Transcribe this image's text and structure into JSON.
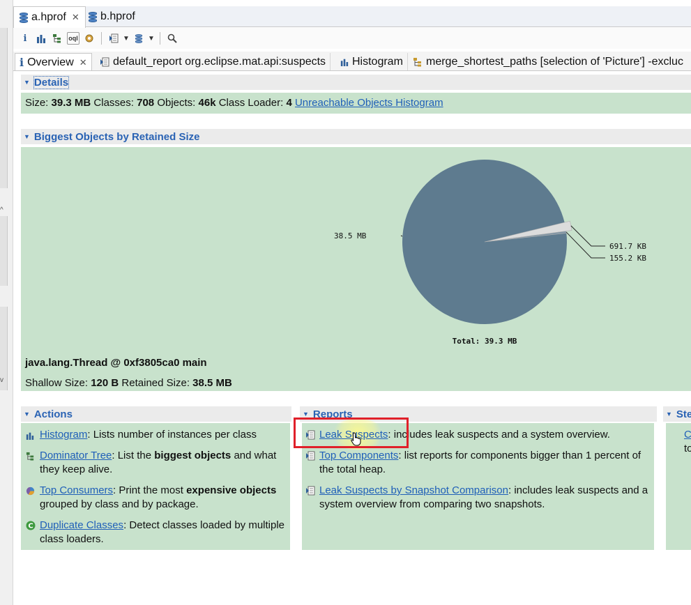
{
  "editor_tabs": [
    {
      "label": "a.hprof",
      "active": true
    },
    {
      "label": "b.hprof",
      "active": false
    }
  ],
  "toolbar": {
    "icons": [
      "info-icon",
      "histogram-icon",
      "dominator-tree-icon",
      "oql-icon",
      "heap-dump-overview-icon",
      "run-report-icon",
      "query-browser-icon",
      "search-icon"
    ]
  },
  "view_tabs": [
    {
      "label": "Overview",
      "active": true
    },
    {
      "label": "default_report  org.eclipse.mat.api:suspects"
    },
    {
      "label": "Histogram"
    },
    {
      "label": "merge_shortest_paths  [selection of 'Picture'] -excluc"
    }
  ],
  "details": {
    "header": "Details",
    "size_label": "Size:",
    "size_value": "39.3 MB",
    "classes_label": "Classes:",
    "classes_value": "708",
    "objects_label": "Objects:",
    "objects_value": "46k",
    "loader_label": "Class Loader:",
    "loader_value": "4",
    "unreachable_link": "Unreachable Objects Histogram"
  },
  "biggest": {
    "header": "Biggest Objects by Retained Size",
    "object_name": "java.lang.Thread @ 0xf3805ca0 main",
    "shallow_label": "Shallow Size:",
    "shallow_value": "120 B",
    "retained_label": "Retained Size:",
    "retained_value": "38.5 MB"
  },
  "chart_data": {
    "type": "pie",
    "slices": [
      {
        "label": "38.5 MB",
        "value": 38.5,
        "color": "#5e7b8f"
      },
      {
        "label": "691.7 KB",
        "value": 0.6755,
        "color": "#dcdcdc"
      },
      {
        "label": "155.2 KB",
        "value": 0.1516,
        "color": "#7f95a5"
      }
    ],
    "total_label": "Total: 39.3 MB"
  },
  "actions": {
    "header": "Actions",
    "items": [
      {
        "link": "Histogram",
        "pre": ": Lists number of instances per class",
        "bold": "",
        "post": ""
      },
      {
        "link": "Dominator Tree",
        "pre": ": List the ",
        "bold": "biggest objects",
        "post": " and what they keep alive."
      },
      {
        "link": "Top Consumers",
        "pre": ": Print the most ",
        "bold": "expensive objects",
        "post": " grouped by class and by package."
      },
      {
        "link": "Duplicate Classes",
        "pre": ": Detect classes loaded by multiple class loaders.",
        "bold": "",
        "post": ""
      }
    ]
  },
  "reports": {
    "header": "Reports",
    "items": [
      {
        "link": "Leak Suspects",
        "text": ": includes leak suspects and a system overview."
      },
      {
        "link": "Top Components",
        "text": ": list reports for components bigger than 1 percent of the total heap."
      },
      {
        "link": "Leak Suspects by Snapshot Comparison",
        "text": ": includes leak suspects and a system overview from comparing two snapshots."
      }
    ]
  },
  "steps": {
    "header": "Ste",
    "link": "C",
    "text": "to"
  },
  "colors": {
    "accent": "#2a63b4",
    "panel_green": "#c8e2cc",
    "highlight_red": "#e0202a",
    "pie_main": "#5e7b8f"
  }
}
